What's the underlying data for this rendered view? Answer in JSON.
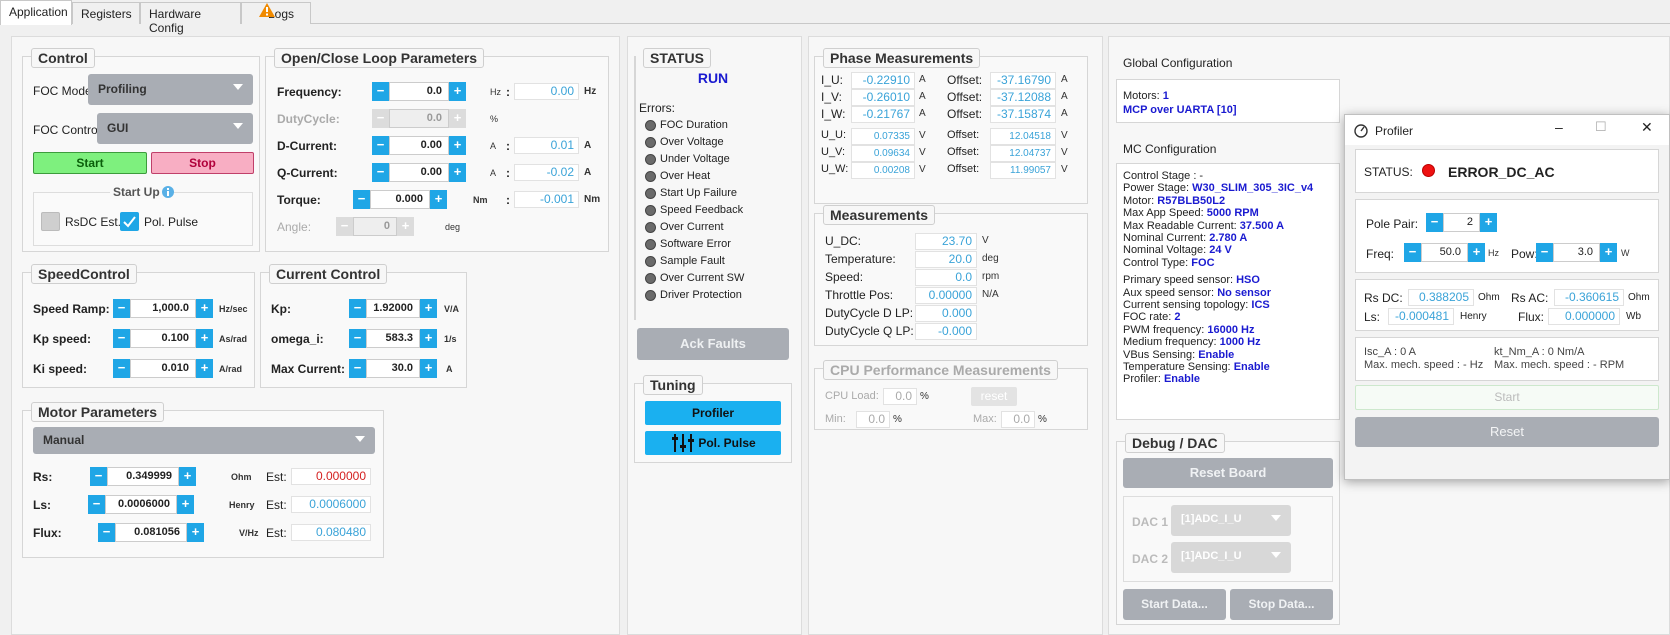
{
  "tabs": [
    "Application",
    "Registers",
    "Hardware Config",
    "Logs"
  ],
  "control": {
    "title": "Control",
    "foc_mode_label": "FOC Mode",
    "foc_mode_value": "Profiling",
    "foc_control_label": "FOC Control",
    "foc_control_value": "GUI",
    "start": "Start",
    "stop": "Stop",
    "startup": "Start Up",
    "rsdc": "RsDC Est.",
    "polpulse": "Pol. Pulse"
  },
  "ocl": {
    "title": "Open/Close Loop Parameters",
    "freq_label": "Frequency:",
    "freq_value": "0.0",
    "freq_unit": "Hz",
    "freq_read": "0.00",
    "freq_read_unit": "Hz",
    "duty_label": "DutyCycle:",
    "duty_value": "0.0",
    "duty_unit": "%",
    "dcur_label": "D-Current:",
    "dcur_value": "0.00",
    "dcur_unit": "A",
    "dcur_read": "0.01",
    "dcur_read_unit": "A",
    "qcur_label": "Q-Current:",
    "qcur_value": "0.00",
    "qcur_unit": "A",
    "qcur_read": "-0.02",
    "qcur_read_unit": "A",
    "torque_label": "Torque:",
    "torque_value": "0.000",
    "torque_unit": "Nm",
    "torque_read": "-0.001",
    "torque_read_unit": "Nm",
    "angle_label": "Angle:",
    "angle_value": "0",
    "angle_unit": "deg",
    "colon": ":"
  },
  "speed": {
    "title": "SpeedControl",
    "ramp_label": "Speed Ramp:",
    "ramp_value": "1,000.0",
    "ramp_unit": "Hz/sec",
    "kp_label": "Kp speed:",
    "kp_value": "0.100",
    "kp_unit": "As/rad",
    "ki_label": "Ki speed:",
    "ki_value": "0.010",
    "ki_unit": "A/rad"
  },
  "current": {
    "title": "Current Control",
    "kp_label": "Kp:",
    "kp_value": "1.92000",
    "kp_unit": "V/A",
    "omega_label": "omega_i:",
    "omega_value": "583.3",
    "omega_unit": "1/s",
    "max_label": "Max Current:",
    "max_value": "30.0",
    "max_unit": "A"
  },
  "motor": {
    "title": "Motor Parameters",
    "mode": "Manual",
    "rs_label": "Rs:",
    "rs_value": "0.349999",
    "rs_unit": "Ohm",
    "rs_est": "0.000000",
    "ls_label": "Ls:",
    "ls_value": "0.0006000",
    "ls_unit": "Henry",
    "ls_est": "0.0006000",
    "flux_label": "Flux:",
    "flux_value": "0.081056",
    "flux_unit": "V/Hz",
    "flux_est": "0.080480",
    "est_label": "Est:"
  },
  "status": {
    "title": "STATUS",
    "state": "RUN",
    "errors_label": "Errors:",
    "errors": [
      "FOC Duration",
      "Over Voltage",
      "Under Voltage",
      "Over Heat",
      "Start Up Failure",
      "Speed Feedback",
      "Over Current",
      "Software Error",
      "Sample Fault",
      "Over Current SW",
      "Driver Protection"
    ],
    "ack": "Ack Faults"
  },
  "tuning": {
    "title": "Tuning",
    "profiler": "Profiler",
    "polpulse": "Pol. Pulse"
  },
  "phase": {
    "title": "Phase Measurements",
    "offset_label": "Offset:",
    "rows": [
      {
        "l": "I_U:",
        "v": "-0.22910",
        "u": "A",
        "o": "-37.16790",
        "ou": "A"
      },
      {
        "l": "I_V:",
        "v": "-0.26010",
        "u": "A",
        "o": "-37.12088",
        "ou": "A"
      },
      {
        "l": "I_W:",
        "v": "-0.21767",
        "u": "A",
        "o": "-37.15874",
        "ou": "A"
      },
      {
        "l": "U_U:",
        "v": "0.07335",
        "u": "V",
        "o": "12.04518",
        "ou": "V"
      },
      {
        "l": "U_V:",
        "v": "0.09634",
        "u": "V",
        "o": "12.04737",
        "ou": "V"
      },
      {
        "l": "U_W:",
        "v": "0.00208",
        "u": "V",
        "o": "11.99057",
        "ou": "V"
      }
    ]
  },
  "meas": {
    "title": "Measurements",
    "rows": [
      {
        "l": "U_DC:",
        "v": "23.70",
        "u": "V"
      },
      {
        "l": "Temperature:",
        "v": "20.0",
        "u": "deg"
      },
      {
        "l": "Speed:",
        "v": "0.0",
        "u": "rpm"
      },
      {
        "l": "Throttle Pos:",
        "v": "0.00000",
        "u": "N/A"
      },
      {
        "l": "DutyCycle D LP:",
        "v": "0.000",
        "u": ""
      },
      {
        "l": "DutyCycle Q LP:",
        "v": "-0.000",
        "u": ""
      }
    ]
  },
  "cpu": {
    "title": "CPU Performance Measurements",
    "load_label": "CPU Load:",
    "load_value": "0.0",
    "min_label": "Min:",
    "min_value": "0.0",
    "max_label": "Max:",
    "max_value": "0.0",
    "pct": "%",
    "reset": "reset"
  },
  "global": {
    "title": "Global Configuration",
    "motors_label": "Motors:",
    "motors_value": "1",
    "mcp": "MCP over UARTA [10]"
  },
  "mc": {
    "title": "MC Configuration",
    "lines": [
      {
        "k": "Control Stage : -",
        "v": ""
      },
      {
        "k": "Power Stage:",
        "v": "W30_SLIM_305_3IC_v4"
      },
      {
        "k": "Motor:",
        "v": "R57BLB50L2"
      },
      {
        "k": "Max App Speed:",
        "v": "5000 RPM"
      },
      {
        "k": "Max Readable Current:",
        "v": "37.500 A"
      },
      {
        "k": "Nominal Current:",
        "v": "2.780 A"
      },
      {
        "k": "Nominal Voltage:",
        "v": "24 V"
      },
      {
        "k": "Control Type:",
        "v": "FOC"
      },
      {
        "k": "Primary speed sensor:",
        "v": "HSO"
      },
      {
        "k": "Aux speed sensor:",
        "v": "No sensor"
      },
      {
        "k": "Current sensing topology:",
        "v": "ICS"
      },
      {
        "k": "FOC rate:",
        "v": "2"
      },
      {
        "k": "PWM frequency:",
        "v": "16000 Hz"
      },
      {
        "k": "Medium frequency:",
        "v": "1000 Hz"
      },
      {
        "k": "VBus Sensing:",
        "v": "Enable"
      },
      {
        "k": "Temperature Sensing:",
        "v": "Enable"
      },
      {
        "k": "Profiler:",
        "v": "Enable"
      }
    ]
  },
  "debug": {
    "title": "Debug / DAC",
    "reset": "Reset Board",
    "dac1_label": "DAC 1",
    "dac1_value": "[1]ADC_I_U",
    "dac2_label": "DAC 2",
    "dac2_value": "[1]ADC_I_U",
    "start": "Start Data...",
    "stop": "Stop Data..."
  },
  "profiler": {
    "title": "Profiler",
    "status_label": "STATUS:",
    "status_value": "ERROR_DC_AC",
    "pole_label": "Pole Pair:",
    "pole_value": "2",
    "freq_label": "Freq:",
    "freq_value": "50.0",
    "freq_unit": "Hz",
    "pow_label": "Pow:",
    "pow_value": "3.0",
    "pow_unit": "W",
    "rsdc_label": "Rs DC:",
    "rsdc_value": "0.388205",
    "rsdc_unit": "Ohm",
    "rsac_label": "Rs AC:",
    "rsac_value": "-0.360615",
    "rsac_unit": "Ohm",
    "ls_label": "Ls:",
    "ls_value": "-0.000481",
    "ls_unit": "Henry",
    "flux_label": "Flux:",
    "flux_value": "0.000000",
    "flux_unit": "Wb",
    "isc": "Isc_A : 0 A",
    "kt": "kt_Nm_A : 0 Nm/A",
    "mech1": "Max. mech. speed  : - Hz",
    "mech2": "Max. mech. speed  : - RPM",
    "start": "Start",
    "reset": "Reset",
    "min_icon": "–",
    "max_icon": "☐",
    "close_icon": "✕"
  },
  "colors": {
    "accent": "#1fa6e6",
    "start_green": "#7ef07e",
    "stop_pink": "#f8aec3",
    "warn": "#f08a00",
    "error_led": "#e11"
  }
}
